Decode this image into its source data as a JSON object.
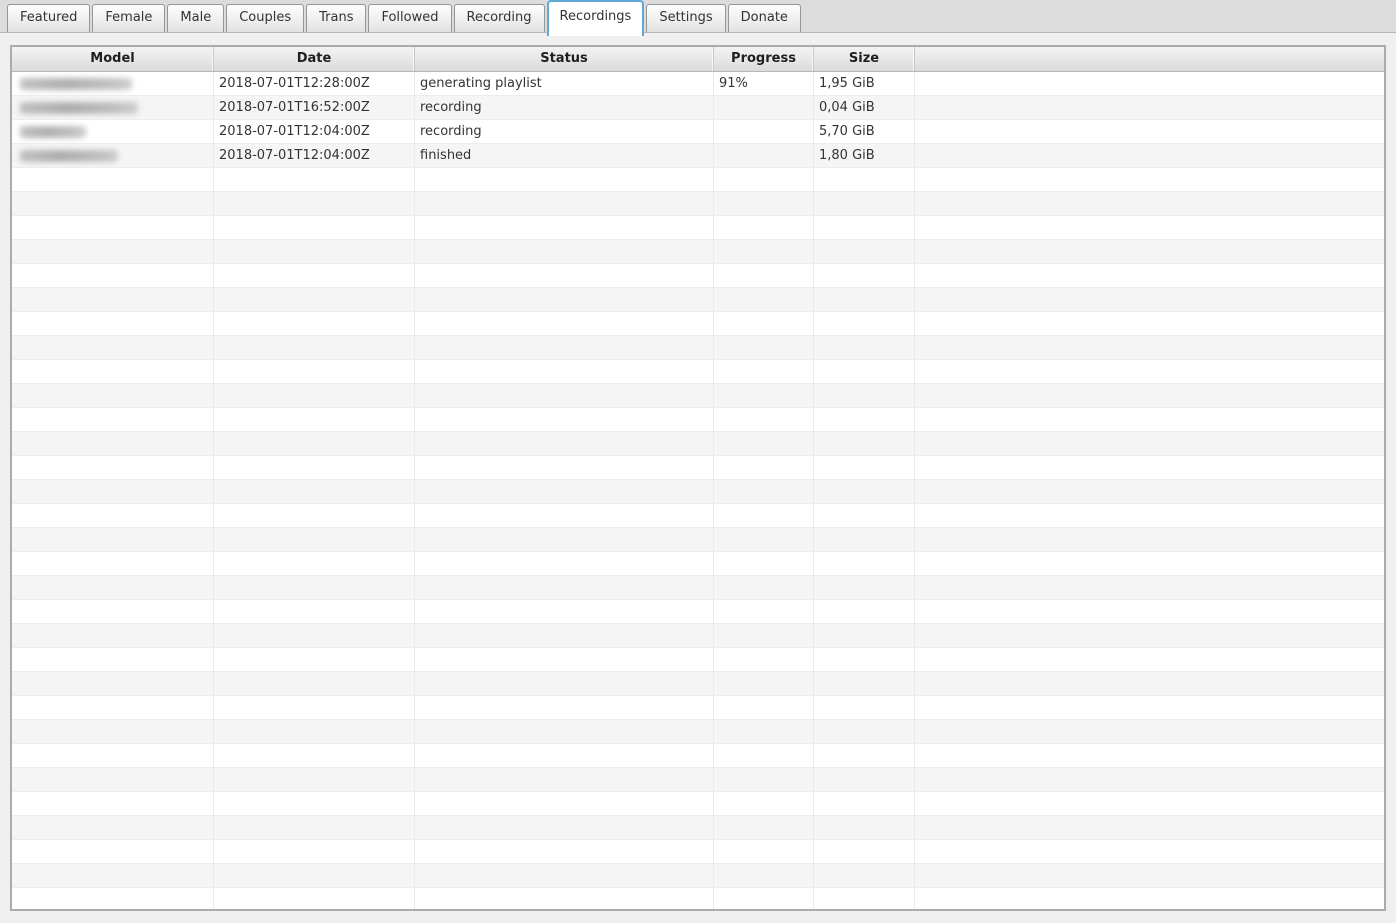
{
  "tabs": {
    "items": [
      {
        "label": "Featured",
        "active": false
      },
      {
        "label": "Female",
        "active": false
      },
      {
        "label": "Male",
        "active": false
      },
      {
        "label": "Couples",
        "active": false
      },
      {
        "label": "Trans",
        "active": false
      },
      {
        "label": "Followed",
        "active": false
      },
      {
        "label": "Recording",
        "active": false
      },
      {
        "label": "Recordings",
        "active": true
      },
      {
        "label": "Settings",
        "active": false
      },
      {
        "label": "Donate",
        "active": false
      }
    ]
  },
  "table": {
    "columns": [
      {
        "key": "model",
        "label": "Model"
      },
      {
        "key": "date",
        "label": "Date"
      },
      {
        "key": "status",
        "label": "Status"
      },
      {
        "key": "progress",
        "label": "Progress"
      },
      {
        "key": "size",
        "label": "Size"
      },
      {
        "key": "filler",
        "label": ""
      }
    ],
    "rows": [
      {
        "model_blurred": true,
        "blur_width": 112,
        "date": "2018-07-01T12:28:00Z",
        "status": "generating playlist",
        "progress": "91%",
        "size": "1,95 GiB"
      },
      {
        "model_blurred": true,
        "blur_width": 118,
        "date": "2018-07-01T16:52:00Z",
        "status": "recording",
        "progress": "",
        "size": "0,04 GiB"
      },
      {
        "model_blurred": true,
        "blur_width": 66,
        "date": "2018-07-01T12:04:00Z",
        "status": "recording",
        "progress": "",
        "size": "5,70 GiB"
      },
      {
        "model_blurred": true,
        "blur_width": 98,
        "date": "2018-07-01T12:04:00Z",
        "status": "finished",
        "progress": "",
        "size": "1,80 GiB"
      }
    ],
    "empty_row_count": 31
  },
  "colors": {
    "active_tab_border": "#5fa8d8",
    "row_stripe": "#f5f5f5",
    "tab_strip_background": "#dcdcdc",
    "page_background": "#f0f0f0"
  }
}
